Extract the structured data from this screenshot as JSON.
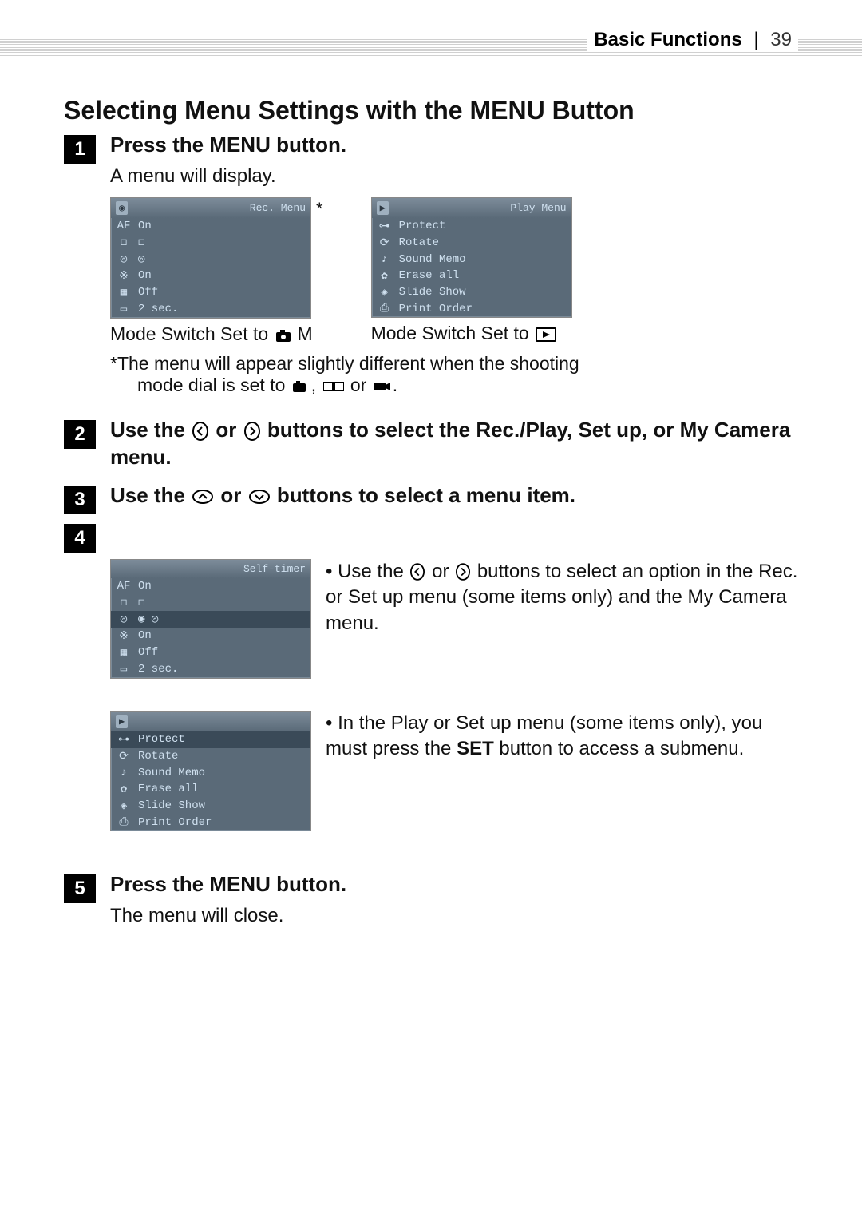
{
  "header": {
    "section": "Basic Functions",
    "page_number": "39"
  },
  "title": "Selecting Menu Settings with the MENU Button",
  "steps": {
    "s1": {
      "num": "1",
      "head_prefix": "Press the ",
      "head_menu": "MENU",
      "head_suffix": " button.",
      "body": "A menu will display.",
      "rec_menu": {
        "title": "Rec. Menu",
        "rows": [
          {
            "icon": "AF",
            "val": "On"
          },
          {
            "icon": "◻",
            "val": "◻"
          },
          {
            "icon": "◎",
            "val": "◎"
          },
          {
            "icon": "※",
            "val": "On"
          },
          {
            "icon": "▦",
            "val": "Off"
          },
          {
            "icon": "▭",
            "val": "2 sec."
          }
        ]
      },
      "play_menu": {
        "title": "Play Menu",
        "rows": [
          {
            "icon": "⊶",
            "label": "Protect"
          },
          {
            "icon": "⟳",
            "label": "Rotate"
          },
          {
            "icon": "♪",
            "label": "Sound Memo"
          },
          {
            "icon": "✿",
            "label": "Erase all"
          },
          {
            "icon": "◈",
            "label": "Slide Show"
          },
          {
            "icon": "⎙",
            "label": "Print Order"
          }
        ]
      },
      "caption_rec_prefix": "Mode Switch Set to ",
      "caption_rec_icon_label": "M",
      "caption_play_prefix": "Mode Switch Set to ",
      "footnote_line1": "*The menu will appear slightly different when the shooting",
      "footnote_line2_prefix": "mode dial is set to ",
      "footnote_line2_sep1": ", ",
      "footnote_line2_sep2": " or ",
      "footnote_line2_end": "."
    },
    "s2": {
      "num": "2",
      "head_p1": "Use the ",
      "head_p2": " or ",
      "head_p3": " buttons to select the Rec./Play, Set up, or My Camera menu."
    },
    "s3": {
      "num": "3",
      "head_p1": "Use the ",
      "head_p2": " or ",
      "head_p3": " buttons to select a menu item."
    },
    "s4": {
      "num": "4",
      "self_timer_menu": {
        "title": "Self-timer",
        "rows": [
          {
            "icon": "AF",
            "val": "On"
          },
          {
            "icon": "◻",
            "val": "◻"
          },
          {
            "icon": "◎",
            "val": "◉  ◎"
          },
          {
            "icon": "※",
            "val": "On"
          },
          {
            "icon": "▦",
            "val": "Off"
          },
          {
            "icon": "▭",
            "val": "2 sec."
          }
        ],
        "sel_index": 2
      },
      "bullet1_p1": "Use the ",
      "bullet1_p2": " or ",
      "bullet1_p3": " buttons to select an option in the Rec. or Set up menu (some items only) and the My Camera menu.",
      "play_menu2": {
        "rows": [
          {
            "icon": "⊶",
            "label": "Protect"
          },
          {
            "icon": "⟳",
            "label": "Rotate"
          },
          {
            "icon": "♪",
            "label": "Sound Memo"
          },
          {
            "icon": "✿",
            "label": "Erase all"
          },
          {
            "icon": "◈",
            "label": "Slide Show"
          },
          {
            "icon": "⎙",
            "label": "Print Order"
          }
        ],
        "sel_index": 0
      },
      "bullet2_p1": "In the Play or Set up menu (some items only), you must press the ",
      "bullet2_set": "SET",
      "bullet2_p2": " button to access a submenu."
    },
    "s5": {
      "num": "5",
      "head_prefix": "Press the ",
      "head_menu": "MENU",
      "head_suffix": " button.",
      "body": "The menu will close."
    }
  }
}
